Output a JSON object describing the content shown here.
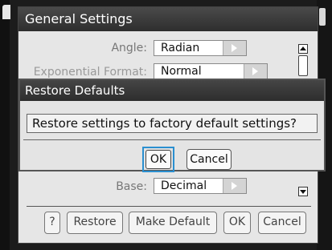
{
  "window": {
    "title": "General Settings"
  },
  "settings": {
    "angle": {
      "label": "Angle:",
      "value": "Radian"
    },
    "exponential_format": {
      "label": "Exponential Format:",
      "value": "Normal"
    },
    "base": {
      "label": "Base:",
      "value": "Decimal"
    }
  },
  "footer": {
    "help_label": "?",
    "restore_label": "Restore",
    "make_default_label": "Make Default",
    "ok_label": "OK",
    "cancel_label": "Cancel"
  },
  "dialog": {
    "title": "Restore Defaults",
    "message": "Restore settings to factory default settings?",
    "ok_label": "OK",
    "cancel_label": "Cancel"
  },
  "colors": {
    "focus": "#2a8fd0",
    "titlebar": "#3a3a3a",
    "panel": "#e6e6e6"
  },
  "icons": {
    "scroll_up": "scroll-up-icon",
    "scroll_down": "scroll-down-icon",
    "combo_arrow": "combo-arrow-icon"
  }
}
